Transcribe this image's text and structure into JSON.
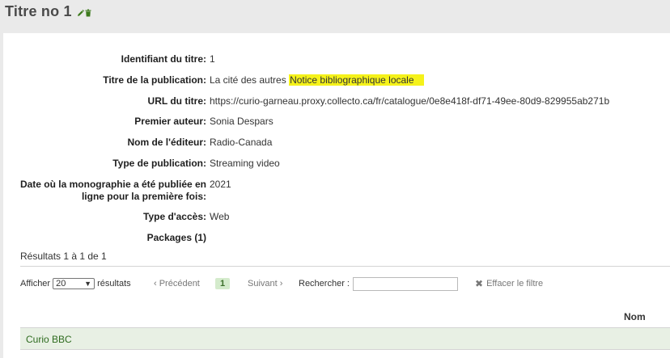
{
  "header": {
    "title": "Titre no 1",
    "icons": [
      "pencil-icon",
      "trash-icon"
    ]
  },
  "details": [
    {
      "label": "Identifiant du titre:",
      "value": "1"
    },
    {
      "label": "Titre de la publication:",
      "value": "La cité des autres",
      "badge": "Notice bibliographique locale"
    },
    {
      "label": "URL du titre:",
      "value": "https://curio-garneau.proxy.collecto.ca/fr/catalogue/0e8e418f-df71-49ee-80d9-829955ab271b"
    },
    {
      "label": "Premier auteur:",
      "value": "Sonia Despars"
    },
    {
      "label": "Nom de l'éditeur:",
      "value": "Radio-Canada"
    },
    {
      "label": "Type de publication:",
      "value": "Streaming video"
    },
    {
      "label": "Date où la monographie a été publiée en ligne pour la première fois:",
      "value": "2021"
    },
    {
      "label": "Type d'accès:",
      "value": "Web"
    },
    {
      "label": "Packages (1)",
      "value": ""
    }
  ],
  "results_count": "Résultats 1 à 1 de 1",
  "table_controls": {
    "show_prefix": "Afficher",
    "page_size": "20",
    "show_suffix": "résultats",
    "prev": "‹ Précédent",
    "current_page": "1",
    "next": "Suivant ›",
    "search_label": "Rechercher :",
    "search_value": "",
    "clear_filter": "Effacer le filtre"
  },
  "table": {
    "columns": [
      "Nom"
    ],
    "rows": [
      [
        "Curio BBC"
      ]
    ]
  },
  "colors": {
    "highlight": "#f5f21a",
    "link_green": "#2e6b1f",
    "row_bg": "#e8f0e4"
  }
}
